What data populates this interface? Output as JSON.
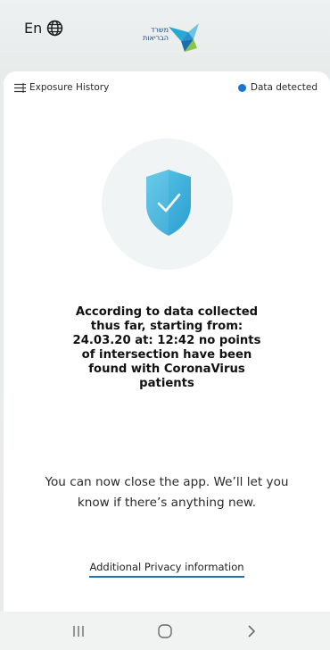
{
  "header": {
    "language_label": "En",
    "logo_text_line1": "משרד",
    "logo_text_line2": "הבריאות"
  },
  "topbar": {
    "history_label": "Exposure History",
    "status_label": "Data detected",
    "status_color": "#1976d2"
  },
  "main": {
    "message": "According to data collected thus far, starting from: 24.03.20 at: 12:42 no points of intersection have been found with CoronaVirus patients",
    "note": "You can now close the app. We’ll let you know if there’s anything new.",
    "privacy_link": "Additional Privacy information"
  },
  "colors": {
    "accent": "#1e73b8",
    "shield": "#3aaed8",
    "shield_light": "#a7dff0"
  },
  "icons": {
    "language": "globe-icon",
    "history": "menu-list-icon",
    "shield": "shield-check-icon",
    "nav_recents": "recents-icon",
    "nav_home": "home-icon",
    "nav_back": "back-icon"
  }
}
